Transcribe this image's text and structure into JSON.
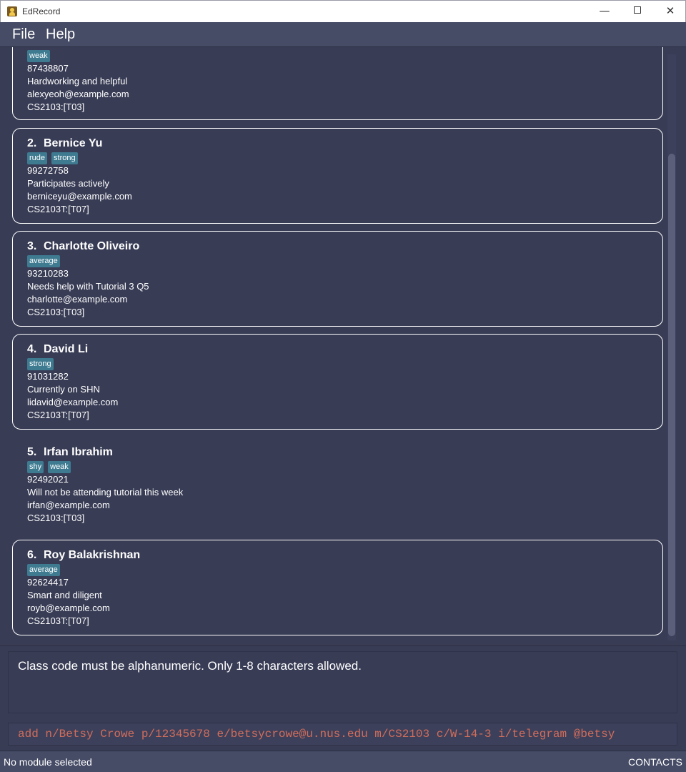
{
  "window": {
    "title": "EdRecord",
    "minimize_glyph": "—",
    "close_glyph": "✕"
  },
  "menu": {
    "file_label": "File",
    "help_label": "Help"
  },
  "persons": [
    {
      "index": "",
      "name": "",
      "tags": [
        "weak"
      ],
      "phone": "87438807",
      "info": "Hardworking and helpful",
      "email": "alexyeoh@example.com",
      "module": "CS2103:[T03]"
    },
    {
      "index": "2.",
      "name": "Bernice Yu",
      "tags": [
        "rude",
        "strong"
      ],
      "phone": "99272758",
      "info": "Participates actively",
      "email": "berniceyu@example.com",
      "module": "CS2103T:[T07]"
    },
    {
      "index": "3.",
      "name": "Charlotte Oliveiro",
      "tags": [
        "average"
      ],
      "phone": "93210283",
      "info": "Needs help with Tutorial 3 Q5",
      "email": "charlotte@example.com",
      "module": "CS2103:[T03]"
    },
    {
      "index": "4.",
      "name": "David Li",
      "tags": [
        "strong"
      ],
      "phone": "91031282",
      "info": "Currently on SHN",
      "email": "lidavid@example.com",
      "module": "CS2103T:[T07]"
    },
    {
      "index": "5.",
      "name": "Irfan Ibrahim",
      "tags": [
        "shy",
        "weak"
      ],
      "phone": "92492021",
      "info": "Will not be attending tutorial this week",
      "email": "irfan@example.com",
      "module": "CS2103:[T03]"
    },
    {
      "index": "6.",
      "name": "Roy Balakrishnan",
      "tags": [
        "average"
      ],
      "phone": "92624417",
      "info": "Smart and diligent",
      "email": "royb@example.com",
      "module": "CS2103T:[T07]"
    }
  ],
  "result": {
    "message": "Class code must be alphanumeric. Only 1-8 characters allowed."
  },
  "command": {
    "value": "add n/Betsy Crowe p/12345678 e/betsycrowe@u.nus.edu m/CS2103 c/W-14-3 i/telegram @betsy"
  },
  "status": {
    "left": "No module selected",
    "right": "CONTACTS"
  },
  "colors": {
    "background": "#383c55",
    "menubar": "#464b66",
    "tag": "#3e7b91",
    "command_text": "#d36d5b"
  }
}
